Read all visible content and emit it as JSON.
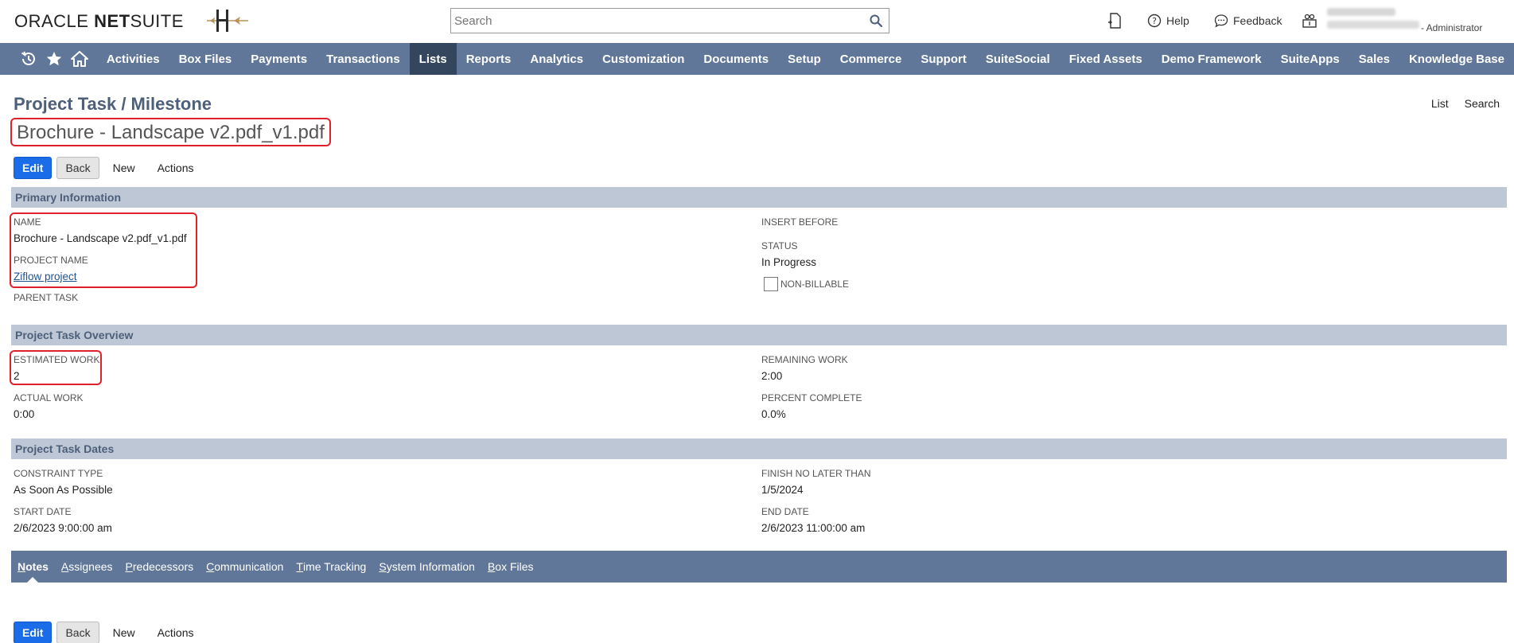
{
  "brand": {
    "oracle": "ORACLE",
    "netsuite_bold": "NET",
    "netsuite_rest": "SUITE"
  },
  "search": {
    "placeholder": "Search"
  },
  "top_links": {
    "help": "Help",
    "feedback": "Feedback",
    "role": "- Administrator"
  },
  "nav": {
    "icons": [
      "recent-icon",
      "star-icon",
      "home-icon"
    ],
    "items": [
      "Activities",
      "Box Files",
      "Payments",
      "Transactions",
      "Lists",
      "Reports",
      "Analytics",
      "Customization",
      "Documents",
      "Setup",
      "Commerce",
      "Support",
      "SuiteSocial",
      "Fixed Assets",
      "Demo Framework",
      "SuiteApps",
      "Sales",
      "Knowledge Base"
    ],
    "active": "Lists"
  },
  "page": {
    "title": "Project Task / Milestone",
    "record_title": "Brochure - Landscape v2.pdf_v1.pdf",
    "links": {
      "list": "List",
      "search": "Search"
    }
  },
  "buttons": {
    "edit": "Edit",
    "back": "Back",
    "new": "New",
    "actions": "Actions"
  },
  "primary": {
    "header": "Primary Information",
    "name_label": "NAME",
    "name_value": "Brochure - Landscape v2.pdf_v1.pdf",
    "project_label": "PROJECT NAME",
    "project_value": "Ziflow project",
    "parent_label": "PARENT TASK",
    "insert_label": "INSERT BEFORE",
    "status_label": "STATUS",
    "status_value": "In Progress",
    "nonbillable_label": "NON-BILLABLE"
  },
  "overview": {
    "header": "Project Task Overview",
    "est_label": "ESTIMATED WORK",
    "est_value": "2",
    "actual_label": "ACTUAL WORK",
    "actual_value": "0:00",
    "remaining_label": "REMAINING WORK",
    "remaining_value": "2:00",
    "percent_label": "PERCENT COMPLETE",
    "percent_value": "0.0%"
  },
  "dates": {
    "header": "Project Task Dates",
    "constraint_label": "CONSTRAINT TYPE",
    "constraint_value": "As Soon As Possible",
    "start_label": "START DATE",
    "start_value": "2/6/2023 9:00:00 am",
    "finish_label": "FINISH NO LATER THAN",
    "finish_value": "1/5/2024",
    "end_label": "END DATE",
    "end_value": "2/6/2023 11:00:00 am"
  },
  "tabs": [
    {
      "first": "N",
      "rest": "otes"
    },
    {
      "first": "A",
      "rest": "ssignees"
    },
    {
      "first": "P",
      "rest": "redecessors"
    },
    {
      "first": "C",
      "rest": "ommunication"
    },
    {
      "first": "T",
      "rest": "ime Tracking"
    },
    {
      "first": "S",
      "rest": "ystem Information"
    },
    {
      "first": "B",
      "rest": "ox Files"
    }
  ],
  "colors": {
    "nav": "#607799",
    "nav_active": "#34455e",
    "section": "#bdc7d6",
    "primary_button": "#1a6ce9",
    "highlight": "#e0212b"
  }
}
